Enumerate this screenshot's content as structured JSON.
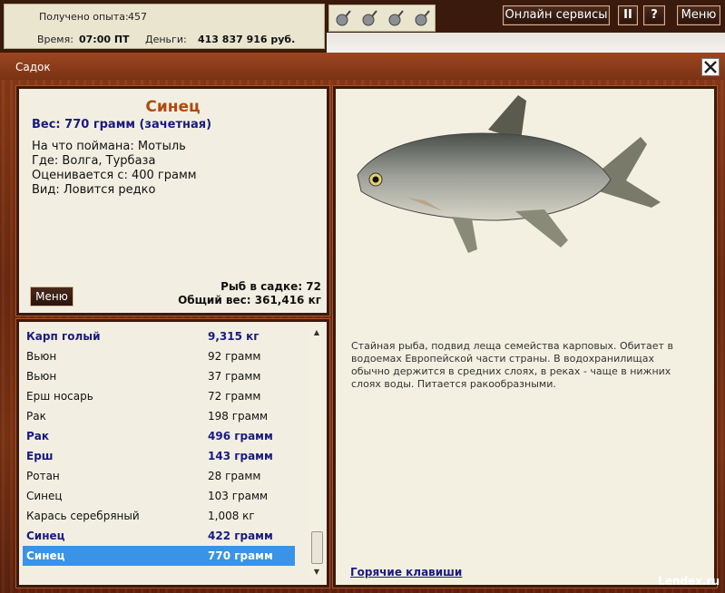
{
  "top": {
    "xp_label": "Получено опыта:",
    "xp_value": "457",
    "time_label": "Время:",
    "time_value": "07:00 ПТ",
    "money_label": "Деньги:",
    "money_value": "413 837 916 руб.",
    "bait_icons": [
      "bait-icon",
      "bait-icon",
      "bait-icon",
      "bait-icon"
    ],
    "online_label": "Онлайн сервисы",
    "pause_label": "II",
    "help_label": "?",
    "menu_label": "Меню"
  },
  "window": {
    "title": "Садок",
    "close_icon": "close-icon"
  },
  "fish": {
    "name": "Синец",
    "weight": "Вес: 770 грамм (зачетная)",
    "bait": "На что поймана: Мотыль",
    "place": "Где: Волга, Турбаза",
    "valued": "Оценивается с: 400 грамм",
    "kind": "Вид: Ловится редко",
    "menu_button": "Меню",
    "count": "Рыб в садке: 72",
    "total": "Общий вес: 361,416 кг",
    "description": "Стайная рыба, подвид леща семейства карповых. Обитает в водоемах Европейской части страны. В водохранилищах обычно держится в средних слоях, в реках - чаще в нижних слоях воды. Питается ракообразными."
  },
  "catch_list": [
    {
      "name": "Карп голый",
      "weight": "9,315 кг",
      "style": "bold"
    },
    {
      "name": "Вьюн",
      "weight": "92 грамм",
      "style": "normal"
    },
    {
      "name": "Вьюн",
      "weight": "37 грамм",
      "style": "normal"
    },
    {
      "name": "Ерш носарь",
      "weight": "72 грамм",
      "style": "normal"
    },
    {
      "name": "Рак",
      "weight": "198 грамм",
      "style": "normal"
    },
    {
      "name": "Рак",
      "weight": "496 грамм",
      "style": "bold"
    },
    {
      "name": "Ерш",
      "weight": "143 грамм",
      "style": "bold"
    },
    {
      "name": "Ротан",
      "weight": "28 грамм",
      "style": "normal"
    },
    {
      "name": "Синец",
      "weight": "103 грамм",
      "style": "normal"
    },
    {
      "name": "Карась серебряный",
      "weight": "1,008 кг",
      "style": "normal"
    },
    {
      "name": "Синец",
      "weight": "422 грамм",
      "style": "bold"
    },
    {
      "name": "Синец",
      "weight": "770 грамм",
      "style": "selected"
    }
  ],
  "hotkeys_link": "Горячие клавиши",
  "watermark": "Lendex.ru",
  "colors": {
    "accent_title": "#b04a12",
    "link_blue": "#1a1a80",
    "selection": "#3a93e6"
  }
}
